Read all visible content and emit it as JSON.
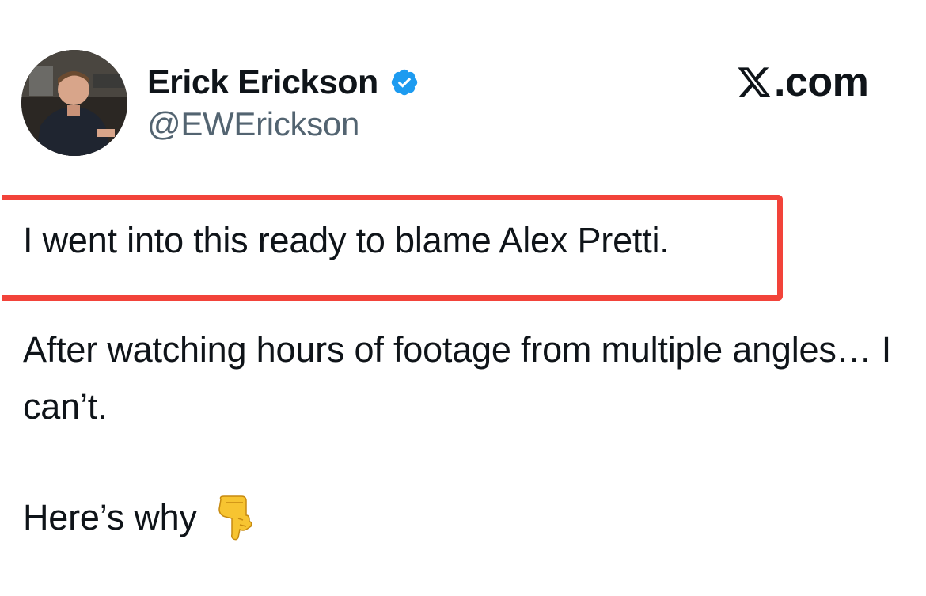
{
  "author": {
    "display_name": "Erick Erickson",
    "handle": "@EWErickson",
    "verified_icon": "verified-badge-icon"
  },
  "source": {
    "logo_icon": "x-logo-icon",
    "domain_suffix": ".com"
  },
  "tweet": {
    "highlighted_sentence": "I went into this ready to blame Alex Pretti.",
    "paragraph_2": "After watching hours of footage from multiple angles… I can’t.",
    "paragraph_3": "Here’s why",
    "emoji_icon": "pointing-down-hand-emoji"
  },
  "colors": {
    "highlight_border": "#f2433a",
    "verified_blue": "#1d9bf0",
    "handle_gray": "#536471",
    "text": "#0f1419"
  }
}
